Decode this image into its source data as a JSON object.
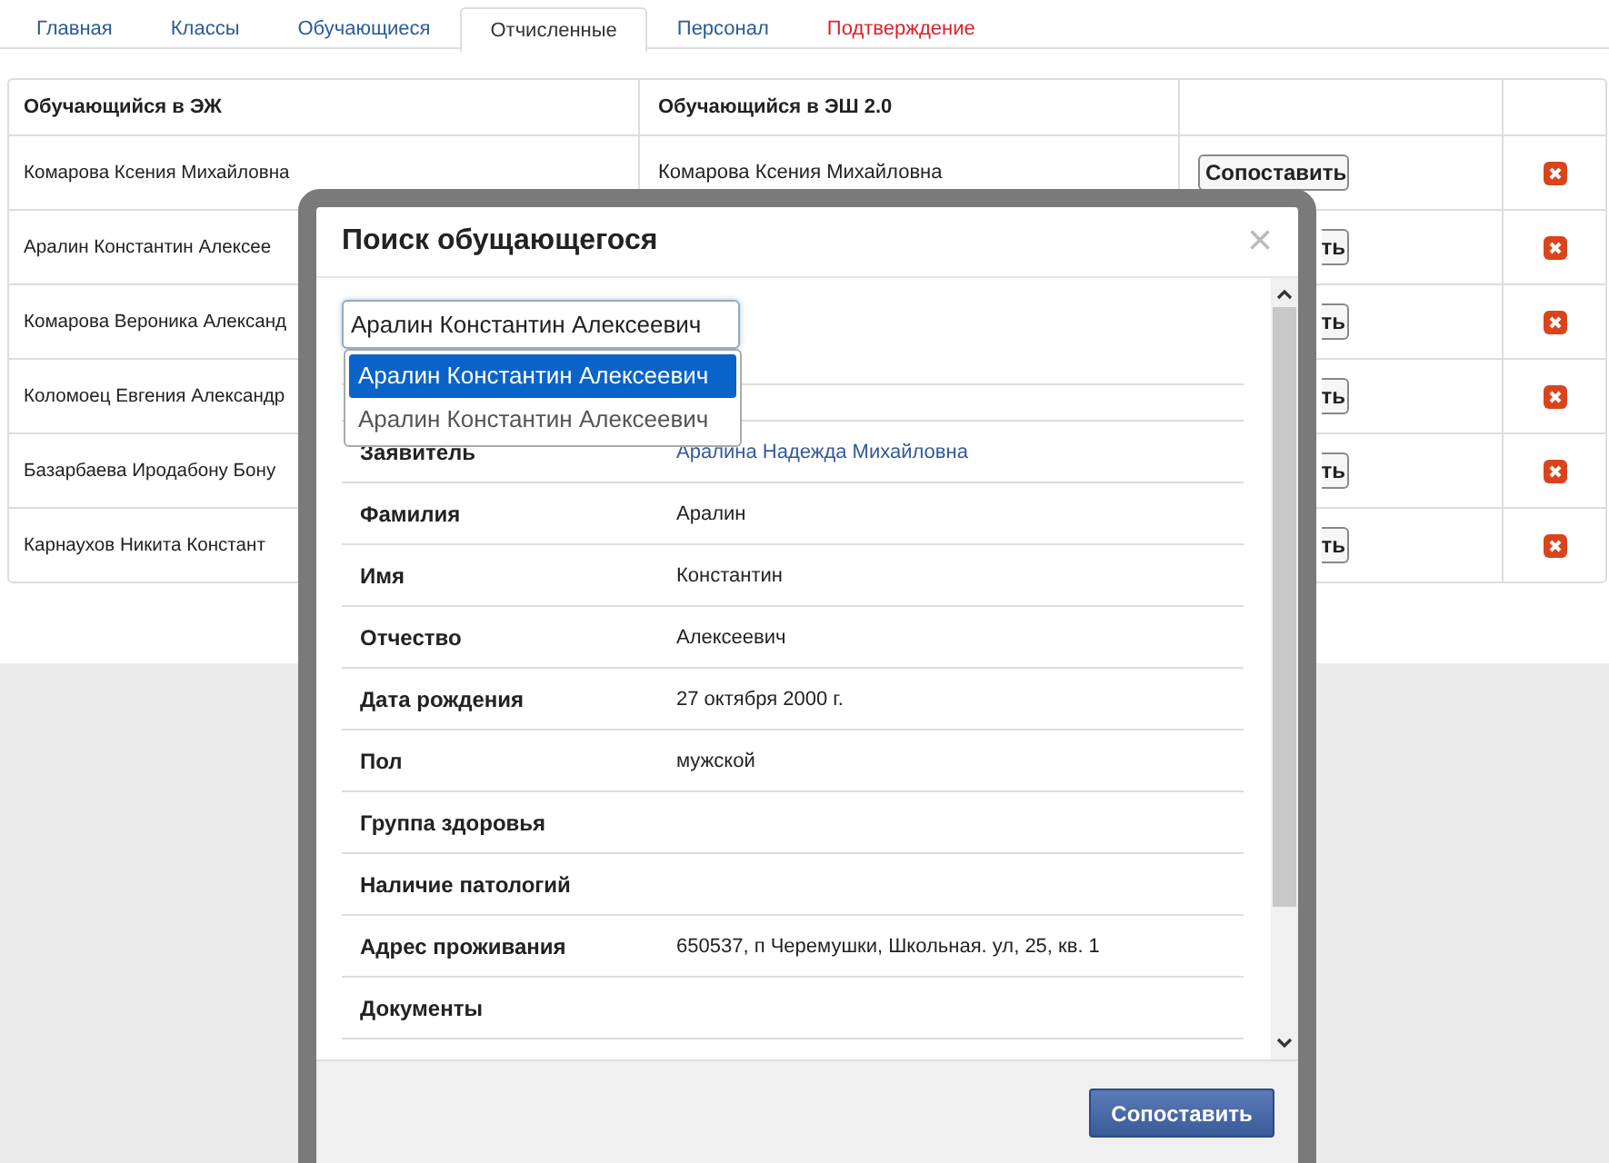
{
  "tabs": [
    {
      "label": "Главная",
      "selected": false,
      "kind": "normal"
    },
    {
      "label": "Классы",
      "selected": false,
      "kind": "normal"
    },
    {
      "label": "Обучающиеся",
      "selected": false,
      "kind": "normal"
    },
    {
      "label": "Отчисленные",
      "selected": true,
      "kind": "normal"
    },
    {
      "label": "Персонал",
      "selected": false,
      "kind": "normal"
    },
    {
      "label": "Подтверждение",
      "selected": false,
      "kind": "alert"
    }
  ],
  "table": {
    "columns": [
      "Обучающийся в ЭЖ",
      "Обучающийся в ЭШ 2.0"
    ],
    "rows": [
      {
        "ej_student": "Комарова Ксения Михайловна",
        "esh_student": "Комарова Ксения Михайловна",
        "button": {
          "label": "Сопоставить",
          "kind": "full"
        }
      },
      {
        "ej_student": "Аралин Константин Алексее",
        "button": {
          "label": "ть",
          "kind": "cut"
        }
      },
      {
        "ej_student": "Комарова Вероника Александ",
        "button": {
          "label": "ть",
          "kind": "cut"
        }
      },
      {
        "ej_student": "Коломоец Евгения Александр",
        "button": {
          "label": "ть",
          "kind": "cut"
        }
      },
      {
        "ej_student": "Базарбаева Иродабону Бону",
        "button": {
          "label": "ть",
          "kind": "cut"
        }
      },
      {
        "ej_student": "Карнаухов Никита Констант",
        "button": {
          "label": "ть",
          "kind": "cut"
        }
      }
    ]
  },
  "dialog": {
    "title": "Поиск обущающегося",
    "close": "×",
    "search": {
      "value": "Аралин Константин Алексеевич"
    },
    "suggestions": [
      {
        "label": "Аралин Константин Алексеевич",
        "selected": true
      },
      {
        "label": "Аралин Константин Алексеевич",
        "selected": false
      }
    ],
    "fields": [
      {
        "label": "Заявитель",
        "value": "Аралина Надежда Михайловна",
        "kind": "link"
      },
      {
        "label": "Фамилия",
        "value": "Аралин",
        "kind": "text"
      },
      {
        "label": "Имя",
        "value": "Константин",
        "kind": "text"
      },
      {
        "label": "Отчество",
        "value": "Алексеевич",
        "kind": "text"
      },
      {
        "label": "Дата рождения",
        "value": "27 октября 2000 г.",
        "kind": "text"
      },
      {
        "label": "Пол",
        "value": "мужской",
        "kind": "text"
      },
      {
        "label": "Группа здоровья"
      },
      {
        "label": "Наличие патологий"
      },
      {
        "label": "Адрес проживания",
        "value": "650537, п Черемушки, Школьная. ул, 25, кв. 1",
        "kind": "text"
      },
      {
        "label": "Документы"
      }
    ],
    "button": "Сопоставить"
  }
}
